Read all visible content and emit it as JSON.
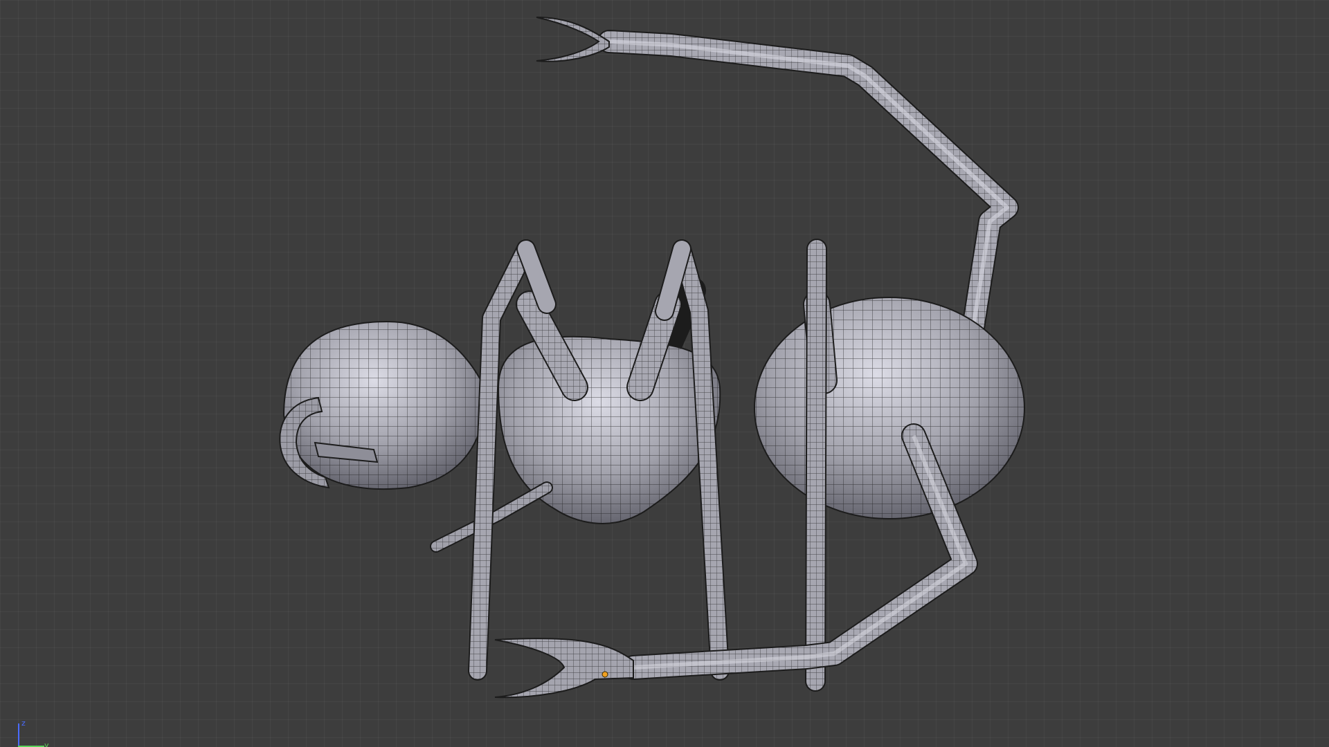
{
  "viewport": {
    "background_color": "#3d3d3d",
    "grid_color": "#4a4a4a",
    "mesh_fill": "#9a9aa4",
    "mesh_highlight": "#d6d6e0",
    "mesh_shadow": "#5c5c66",
    "wire_color": "#1c1c1c",
    "selected_vertex_color": "#f0a020"
  },
  "object": {
    "icon": "ant-mesh-icon"
  },
  "axis_gizmo": {
    "z_label": "z",
    "y_label": "y",
    "z_color": "#4a6cff",
    "y_color": "#5ad25a"
  }
}
